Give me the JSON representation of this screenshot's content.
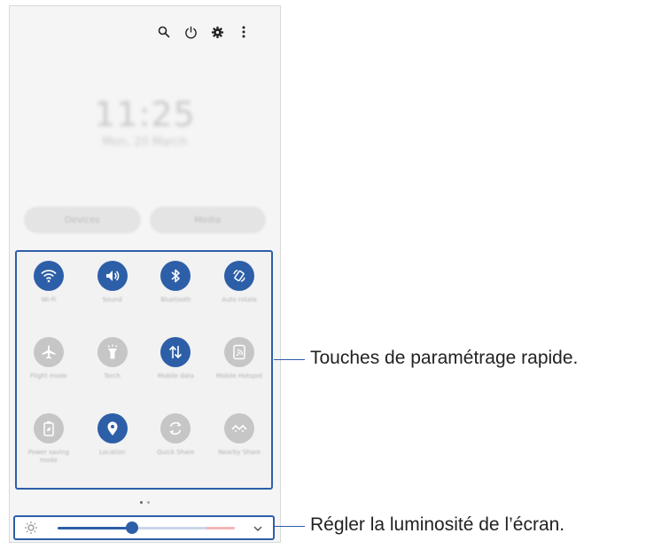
{
  "status": {
    "icons": [
      "search-icon",
      "power-icon",
      "gear-icon",
      "more-vertical-icon"
    ]
  },
  "clock": {
    "time": "11:25",
    "date": "Mon, 20 March"
  },
  "buttons": {
    "devices_label": "Devices",
    "media_label": "Media"
  },
  "quick_settings": {
    "tiles": [
      {
        "label": "Wi-Fi",
        "icon": "wifi-icon",
        "active": true
      },
      {
        "label": "Sound",
        "icon": "sound-icon",
        "active": true
      },
      {
        "label": "Bluetooth",
        "icon": "bluetooth-icon",
        "active": true
      },
      {
        "label": "Auto rotate",
        "icon": "auto-rotate-icon",
        "active": true
      },
      {
        "label": "Flight mode",
        "icon": "airplane-icon",
        "active": false
      },
      {
        "label": "Torch",
        "icon": "torch-icon",
        "active": false
      },
      {
        "label": "Mobile data",
        "icon": "mobile-data-icon",
        "active": true
      },
      {
        "label": "Mobile Hotspot",
        "icon": "hotspot-icon",
        "active": false
      },
      {
        "label": "Power saving mode",
        "icon": "battery-icon",
        "active": false
      },
      {
        "label": "Location",
        "icon": "location-icon",
        "active": true
      },
      {
        "label": "Quick Share",
        "icon": "quick-share-icon",
        "active": false
      },
      {
        "label": "Nearby Share",
        "icon": "nearby-share-icon",
        "active": false
      }
    ]
  },
  "brightness": {
    "level_fraction": 0.42
  },
  "callouts": {
    "quick_settings": "Touches de paramétrage rapide.",
    "brightness": "Régler la luminosité de l’écran."
  },
  "colors": {
    "accent": "#2d5fa8",
    "inactive": "#c6c6c6"
  }
}
